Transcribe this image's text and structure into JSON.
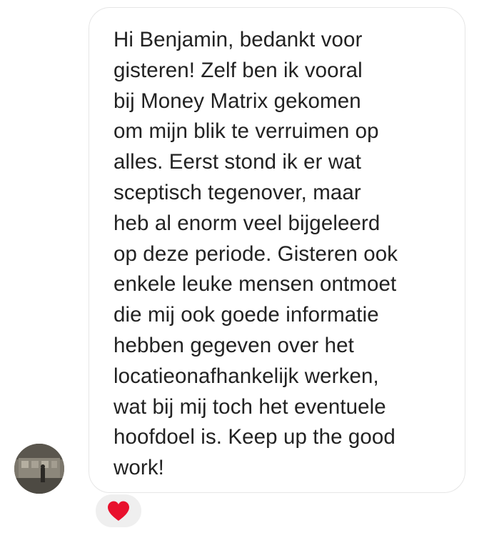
{
  "message": {
    "text": "Hi Benjamin, bedankt voor\ngisteren! Zelf ben ik vooral\nbij Money Matrix gekomen\nom mijn blik te verruimen op\nalles. Eerst stond ik er wat\nsceptisch tegenover, maar\nheb al enorm veel bijgeleerd\nop deze periode. Gisteren ook\nenkele leuke mensen ontmoet\ndie mij ook goede informatie\nhebben gegeven over het\nlocatieonafhankelijk werken,\nwat bij mij toch het eventuele\nhoofdoel is. Keep up the good\nwork!"
  },
  "reaction": {
    "icon": "heart-icon",
    "color": "#e8112d"
  },
  "colors": {
    "bubble_border": "#e6e6e6",
    "text": "#222222",
    "reaction_bg": "#efefef"
  }
}
